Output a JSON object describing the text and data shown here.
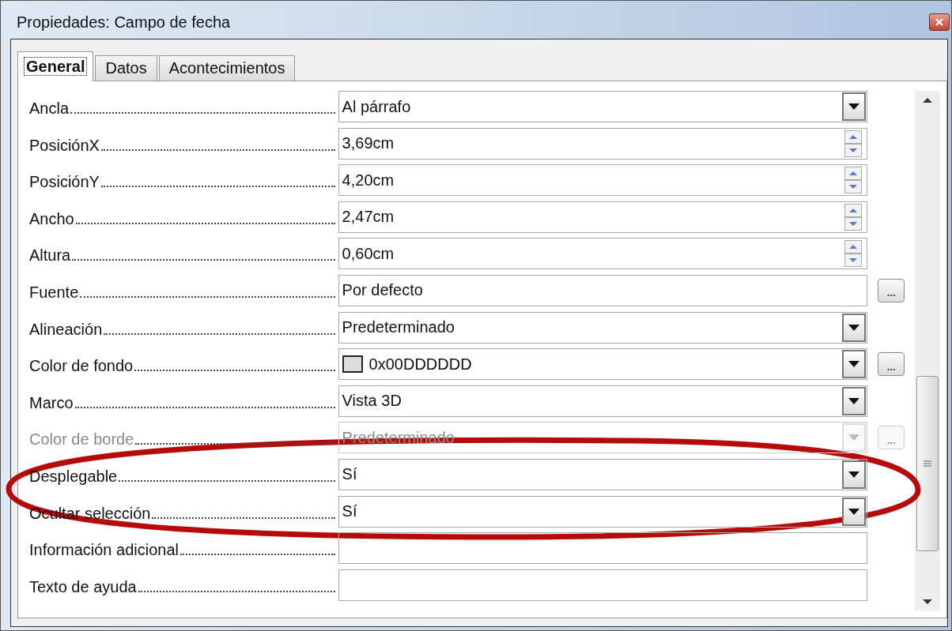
{
  "window": {
    "title": "Propiedades: Campo de fecha"
  },
  "tabs": [
    {
      "label": "General",
      "selected": true
    },
    {
      "label": "Datos",
      "selected": false
    },
    {
      "label": "Acontecimientos",
      "selected": false
    }
  ],
  "properties": [
    {
      "label": "Ancla",
      "kind": "dropdown",
      "value": "Al párrafo",
      "disabled": false
    },
    {
      "label": "PosiciónX",
      "kind": "spin",
      "value": "3,69cm",
      "disabled": false
    },
    {
      "label": "PosiciónY",
      "kind": "spin",
      "value": "4,20cm",
      "disabled": false
    },
    {
      "label": "Ancho",
      "kind": "spin",
      "value": "2,47cm",
      "disabled": false
    },
    {
      "label": "Altura",
      "kind": "spin",
      "value": "0,60cm",
      "disabled": false
    },
    {
      "label": "Fuente",
      "kind": "text",
      "value": "Por defecto",
      "disabled": false,
      "more_button": "..."
    },
    {
      "label": "Alineación",
      "kind": "dropdown",
      "value": "Predeterminado",
      "disabled": false
    },
    {
      "label": "Color de fondo",
      "kind": "color",
      "value": "0x00DDDDDD",
      "color": "#dddddd",
      "disabled": false,
      "more_button": "..."
    },
    {
      "label": "Marco",
      "kind": "dropdown",
      "value": "Vista 3D",
      "disabled": false
    },
    {
      "label": "Color de borde",
      "kind": "dropdown",
      "value": "Predeterminado",
      "disabled": true,
      "more_button": "..."
    },
    {
      "label": "Desplegable",
      "kind": "dropdown",
      "value": "Sí",
      "disabled": false
    },
    {
      "label": "Ocultar selección",
      "kind": "dropdown",
      "value": "Sí",
      "disabled": false
    },
    {
      "label": "Información adicional",
      "kind": "text",
      "disabled": false
    },
    {
      "label": "Texto de ayuda",
      "kind": "text",
      "disabled": false
    }
  ],
  "annotation": {
    "kind": "ellipse"
  }
}
